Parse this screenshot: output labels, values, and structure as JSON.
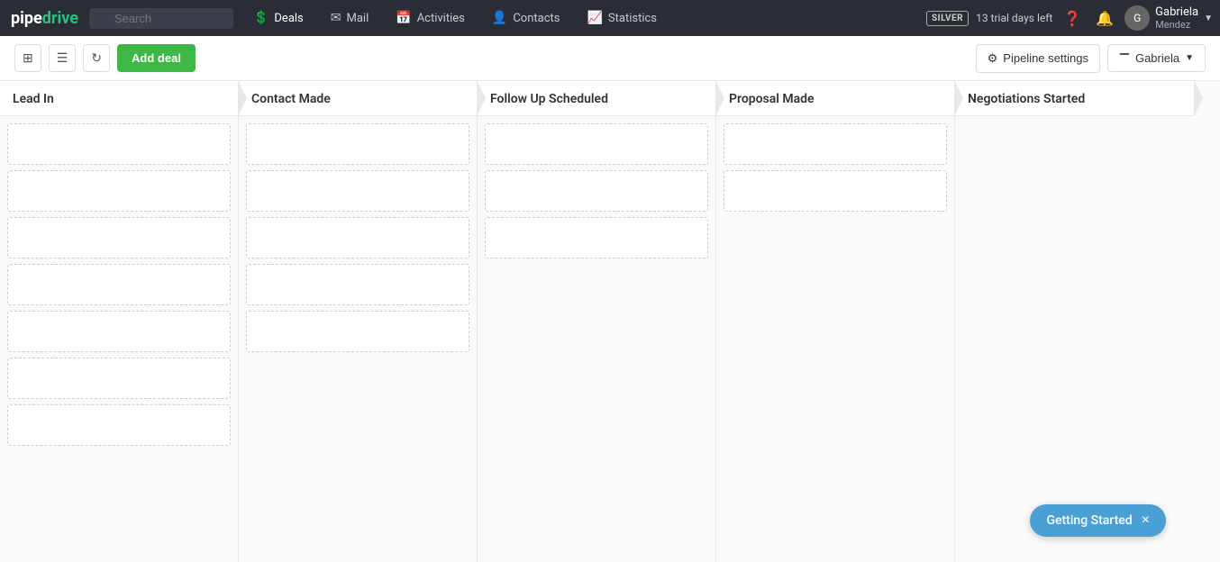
{
  "logo": {
    "text": "pipedrive"
  },
  "search": {
    "placeholder": "Search"
  },
  "nav": {
    "items": [
      {
        "id": "deals",
        "label": "Deals",
        "icon": "💲",
        "active": true
      },
      {
        "id": "mail",
        "label": "Mail",
        "icon": "✉"
      },
      {
        "id": "activities",
        "label": "Activities",
        "icon": "📅"
      },
      {
        "id": "contacts",
        "label": "Contacts",
        "icon": "👤"
      },
      {
        "id": "statistics",
        "label": "Statistics",
        "icon": "📈"
      }
    ],
    "badge": "SILVER",
    "trial": "13 trial days left",
    "user": {
      "name": "Gabriela",
      "sub": "Mendez"
    }
  },
  "toolbar": {
    "view_kanban": "⊞",
    "view_list": "☰",
    "refresh": "↻",
    "add_deal": "Add deal",
    "pipeline_settings": "Pipeline settings",
    "filter": "Gabriela"
  },
  "columns": [
    {
      "id": "lead-in",
      "label": "Lead In",
      "cards": [
        1,
        2,
        3,
        4,
        5,
        6,
        7
      ]
    },
    {
      "id": "contact-made",
      "label": "Contact Made",
      "cards": [
        1,
        2,
        3,
        4,
        5
      ]
    },
    {
      "id": "follow-up",
      "label": "Follow Up Scheduled",
      "cards": [
        1,
        2,
        3
      ]
    },
    {
      "id": "proposal-made",
      "label": "Proposal Made",
      "cards": [
        1,
        2
      ]
    },
    {
      "id": "negotiations",
      "label": "Negotiations Started",
      "cards": []
    }
  ],
  "getting_started": {
    "label": "Getting Started",
    "close": "×"
  }
}
